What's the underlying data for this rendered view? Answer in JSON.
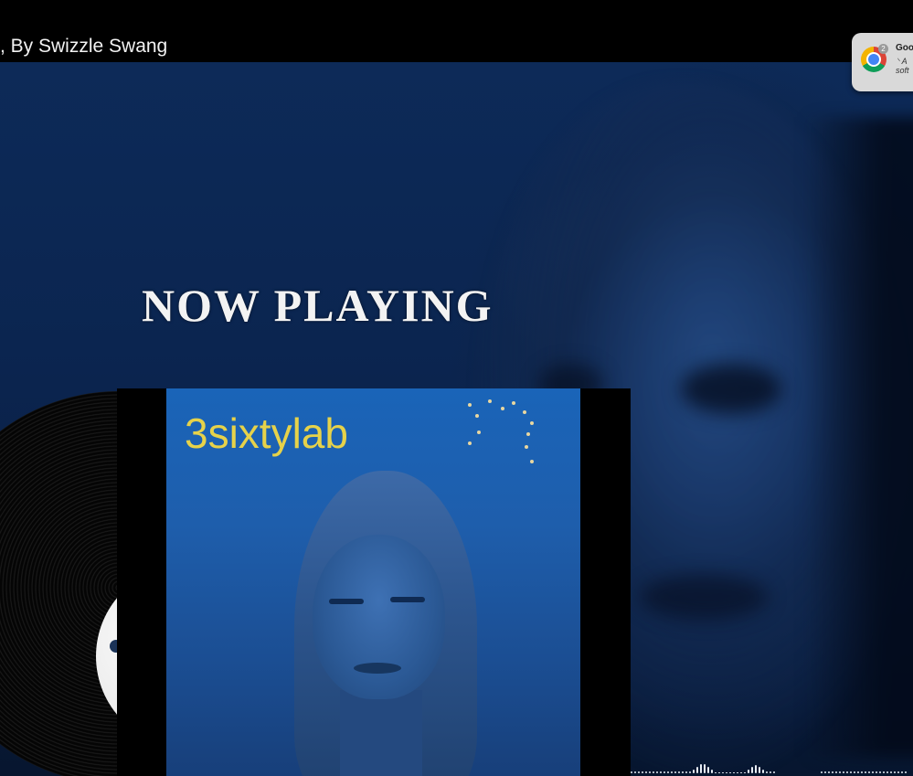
{
  "video": {
    "title": ", By Swizzle Swang",
    "overlay_heading": "NOW PLAYING",
    "cover_brand": "3sixtylab"
  },
  "notification": {
    "app_icon": "chrome-icon",
    "badge_count": "2",
    "title": "Goo",
    "line1": "⸌ A",
    "line2": "soft"
  },
  "colors": {
    "background": "#0b2550",
    "brand_text": "#e6d24a",
    "heading_text": "#f3f3f3"
  }
}
